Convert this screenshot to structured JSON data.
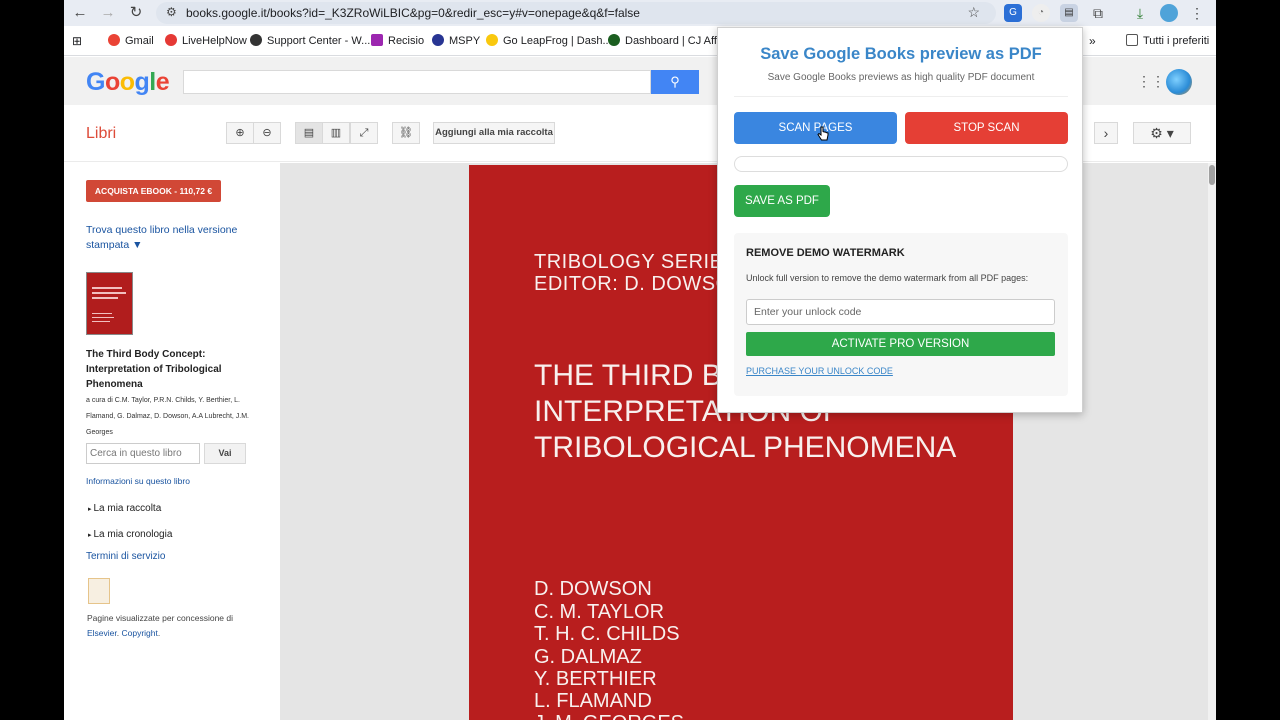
{
  "browser": {
    "url": "books.google.it/books?id=_K3ZRoWiLBIC&pg=0&redir_esc=y#v=onepage&q&f=false",
    "bookmarks": [
      "Gmail",
      "LiveHelpNow",
      "Support Center - W...",
      "Recisio",
      "MSPY",
      "Go LeapFrog | Dash...",
      "Dashboard | CJ Affili..."
    ],
    "all_bookmarks_label": "Tutti i preferiti",
    "more_bookmarks": "»"
  },
  "books": {
    "section_title": "Libri",
    "add_to_collection": "Aggiungi alla mia raccolta",
    "buy_button": "ACQUISTA EBOOK - 110,72 €",
    "find_print_link": "Trova questo libro nella versione stampata ▼",
    "book_title": "The Third Body Concept: Interpretation of Tribological Phenomena",
    "book_authors": "a cura di C.M. Taylor, P.R.N. Childs, Y. Berthier, L. Flamand, G. Dalmaz, D. Dowson, A.A Lubrecht, J.M. Georges",
    "search_in_book_placeholder": "Cerca in questo libro",
    "search_go": "Vai",
    "info_link": "Informazioni su questo libro",
    "my_collection": "La mia raccolta",
    "my_history": "La mia cronologia",
    "terms": "Termini di servizio",
    "courtesy_prefix": "Pagine visualizzate per concessione di",
    "courtesy_publisher": "Elsevier",
    "courtesy_copyright": "Copyright"
  },
  "cover": {
    "series_line1": "TRIBOLOGY SERIES",
    "series_line2": "EDITOR: D. DOWSON",
    "title_line1": "THE THIRD BODY CONCEPT",
    "title_line2": "INTERPRETATION OF",
    "title_line3": "TRIBOLOGICAL PHENOMENA",
    "authors": [
      "D. DOWSON",
      "C. M. TAYLOR",
      "T. H. C. CHILDS",
      "G. DALMAZ",
      "Y. BERTHIER",
      "L. FLAMAND",
      "J. M. GEORGES"
    ]
  },
  "popup": {
    "title": "Save Google Books preview as PDF",
    "subtitle": "Save Google Books previews as high quality PDF document",
    "scan_button": "SCAN PAGES",
    "stop_button": "STOP SCAN",
    "progress": 0,
    "save_button": "SAVE AS PDF",
    "watermark_title": "REMOVE DEMO WATERMARK",
    "watermark_desc": "Unlock full version to remove the demo watermark from all PDF pages:",
    "unlock_placeholder": "Enter your unlock code",
    "activate_button": "ACTIVATE PRO VERSION",
    "purchase_link": "PURCHASE YOUR UNLOCK CODE"
  },
  "colors": {
    "scan_blue": "#3a86e0",
    "stop_red": "#e53f35",
    "save_green": "#2ea84a",
    "cover_red": "#b81e1e",
    "books_red": "#dd4b39"
  }
}
